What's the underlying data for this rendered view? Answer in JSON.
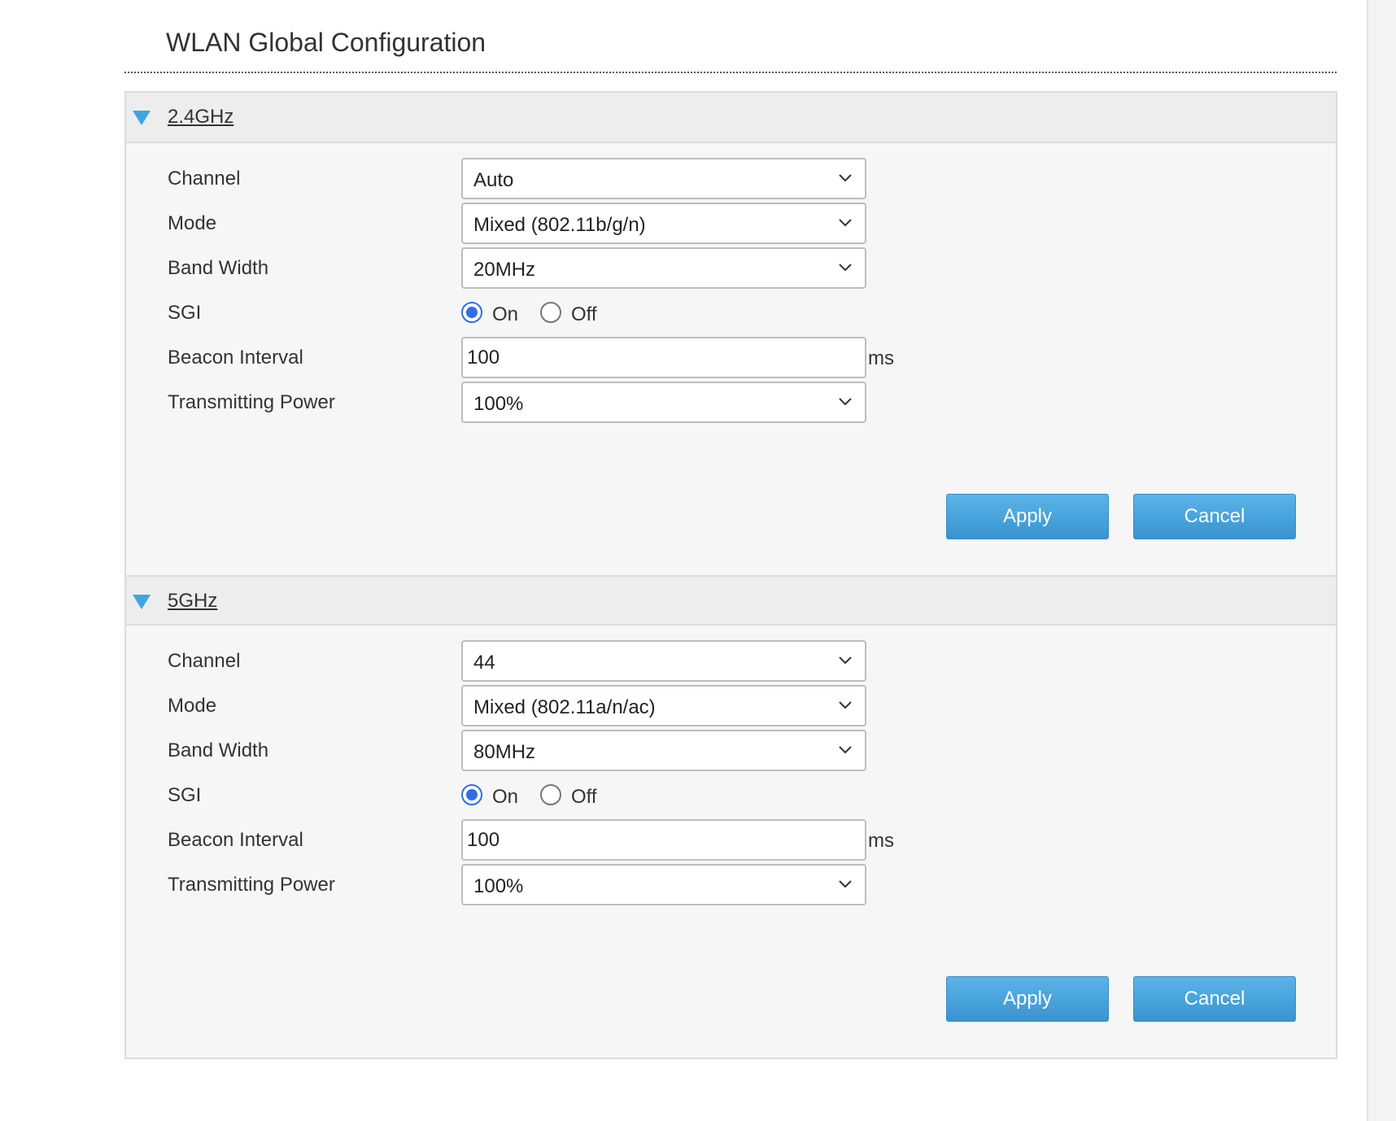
{
  "page": {
    "title": "WLAN Global Configuration"
  },
  "sections": [
    {
      "title": "2.4GHz",
      "icon": "collapse-triangle-icon",
      "channel": {
        "label": "Channel",
        "value": "Auto"
      },
      "mode": {
        "label": "Mode",
        "value": "Mixed (802.11b/g/n)"
      },
      "bandwidth": {
        "label": "Band Width",
        "value": "20MHz"
      },
      "sgi": {
        "label": "SGI",
        "on_label": "On",
        "off_label": "Off",
        "selected": "On"
      },
      "beacon": {
        "label": "Beacon Interval",
        "value": "100",
        "unit": "ms"
      },
      "power": {
        "label": "Transmitting Power",
        "value": "100%"
      },
      "apply_label": "Apply",
      "cancel_label": "Cancel"
    },
    {
      "title": "5GHz",
      "icon": "collapse-triangle-icon",
      "channel": {
        "label": "Channel",
        "value": "44"
      },
      "mode": {
        "label": "Mode",
        "value": "Mixed (802.11a/n/ac)"
      },
      "bandwidth": {
        "label": "Band Width",
        "value": "80MHz"
      },
      "sgi": {
        "label": "SGI",
        "on_label": "On",
        "off_label": "Off",
        "selected": "On"
      },
      "beacon": {
        "label": "Beacon Interval",
        "value": "100",
        "unit": "ms"
      },
      "power": {
        "label": "Transmitting Power",
        "value": "100%"
      },
      "apply_label": "Apply",
      "cancel_label": "Cancel"
    }
  ],
  "colors": {
    "accent": "#3fa6e0",
    "button": "#4aa3dc",
    "radio_checked": "#2f6fe0",
    "panel_bg": "#f6f6f6",
    "header_bg": "#ededed"
  }
}
